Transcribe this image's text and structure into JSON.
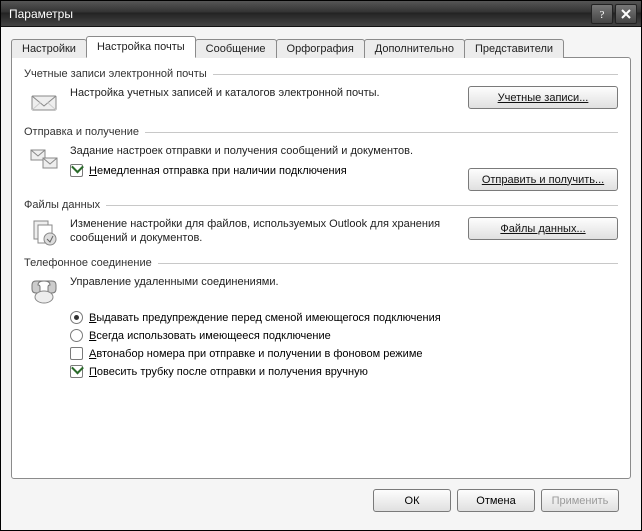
{
  "window": {
    "title": "Параметры"
  },
  "tabs": {
    "t0": "Настройки",
    "t1": "Настройка почты",
    "t2": "Сообщение",
    "t3": "Орфография",
    "t4": "Дополнительно",
    "t5": "Представители"
  },
  "groups": {
    "accounts": {
      "title": "Учетные записи электронной почты",
      "desc": "Настройка учетных записей и каталогов электронной почты.",
      "button": "Учетные записи..."
    },
    "sendrecv": {
      "title": "Отправка и получение",
      "desc": "Задание настроек отправки и получения сообщений и документов.",
      "check_prefix": "Н",
      "check_rest": "емедленная отправка при наличии подключения",
      "button": "Отправить и получить..."
    },
    "datafiles": {
      "title": "Файлы данных",
      "desc": "Изменение настройки для файлов, используемых Outlook для хранения сообщений и документов.",
      "button": "Файлы данных..."
    },
    "dial": {
      "title": "Телефонное соединение",
      "desc": "Управление удаленными соединениями.",
      "warn_prefix": "В",
      "warn_rest": "ыдавать предупреждение перед сменой имеющегося подключения",
      "always_prefix": "В",
      "always_rest": "сегда использовать имеющееся подключение",
      "autodial_prefix": "А",
      "autodial_rest": "втонабор номера при отправке и получении в фоновом режиме",
      "hangup_prefix": "П",
      "hangup_rest": "овесить трубку после отправки и получения вручную"
    }
  },
  "footer": {
    "ok": "ОК",
    "cancel": "Отмена",
    "apply": "Применить"
  }
}
